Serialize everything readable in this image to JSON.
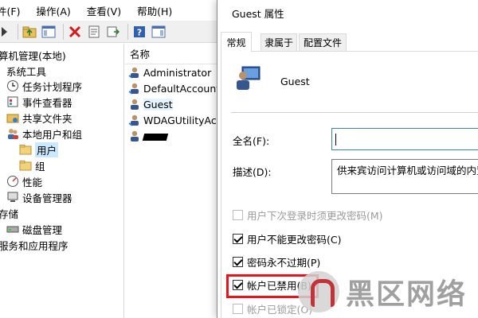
{
  "menu": [
    {
      "label": "件(F)"
    },
    {
      "label": "操作(A)"
    },
    {
      "label": "查看(V)"
    },
    {
      "label": "帮助(H)"
    }
  ],
  "tree": {
    "items": [
      {
        "label": "算机管理(本地)",
        "icon": "computer-management-icon"
      },
      {
        "label": "系统工具",
        "icon": "none"
      },
      {
        "label": "任务计划程序",
        "icon": "clock-icon"
      },
      {
        "label": "事件查看器",
        "icon": "event-viewer-icon"
      },
      {
        "label": "共享文件夹",
        "icon": "shared-folder-icon"
      },
      {
        "label": "本地用户和组",
        "icon": "users-icon"
      },
      {
        "label": "用户",
        "icon": "folder-icon"
      },
      {
        "label": "组",
        "icon": "folder-icon"
      },
      {
        "label": "性能",
        "icon": "performance-icon"
      },
      {
        "label": "设备管理器",
        "icon": "device-manager-icon"
      },
      {
        "label": "存储",
        "icon": "none"
      },
      {
        "label": "磁盘管理",
        "icon": "disk-icon"
      },
      {
        "label": "服务和应用程序",
        "icon": "none"
      }
    ]
  },
  "list": {
    "header": "名称",
    "rows": [
      {
        "label": "Administrator"
      },
      {
        "label": "DefaultAccount"
      },
      {
        "label": "Guest"
      },
      {
        "label": "WDAGUtilityAcc"
      }
    ]
  },
  "dialog": {
    "title": "Guest 属性",
    "tabs": [
      {
        "label": "常规"
      },
      {
        "label": "隶属于"
      },
      {
        "label": "配置文件"
      }
    ],
    "username": "Guest",
    "fullname_label": "全名(F):",
    "fullname_value": "",
    "description_label": "描述(D):",
    "description_value": "供来宾访问计算机或访问域的内置",
    "checkboxes": [
      {
        "label": "用户下次登录时须更改密码(M)",
        "checked": false,
        "enabled": false
      },
      {
        "label": "用户不能更改密码(C)",
        "checked": true,
        "enabled": true
      },
      {
        "label": "密码永不过期(P)",
        "checked": true,
        "enabled": true
      },
      {
        "label": "帐户已禁用(B)",
        "checked": true,
        "enabled": true
      },
      {
        "label": "帐户已锁定(O)",
        "checked": false,
        "enabled": false
      }
    ]
  },
  "watermark": {
    "text": "黑区网络"
  },
  "colors": {
    "highlight_box": "#e8131b",
    "selection": "#cce8ff",
    "focus_border": "#3c7fb1"
  }
}
